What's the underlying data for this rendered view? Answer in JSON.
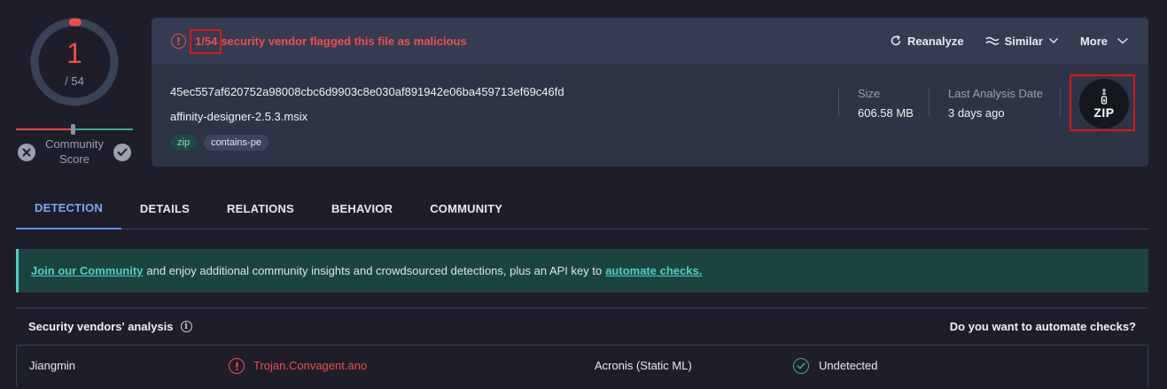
{
  "score": {
    "detections": "1",
    "total": "/ 54",
    "community_label": "Community Score"
  },
  "alert": {
    "count": "1/54",
    "text": "security vendor flagged this file as malicious"
  },
  "actions": {
    "reanalyze": "Reanalyze",
    "similar": "Similar",
    "more": "More"
  },
  "file": {
    "hash": "45ec557af620752a98008cbc6d9903c8e030af891942e06ba459713ef69c46fd",
    "name": "affinity-designer-2.5.3.msix",
    "tags": [
      "zip",
      "contains-pe"
    ]
  },
  "meta": {
    "size_label": "Size",
    "size_value": "606.58 MB",
    "date_label": "Last Analysis Date",
    "date_value": "3 days ago"
  },
  "file_type": "ZIP",
  "tabs": [
    "DETECTION",
    "DETAILS",
    "RELATIONS",
    "BEHAVIOR",
    "COMMUNITY"
  ],
  "banner": {
    "link1": "Join our Community",
    "middle": "and enjoy additional community insights and crowdsourced detections, plus an API key to",
    "link2": "automate checks."
  },
  "vendors": {
    "title": "Security vendors' analysis",
    "automate": "Do you want to automate checks?",
    "rows": [
      {
        "vendor1": "Jiangmin",
        "result1": "Trojan.Convagent.ano",
        "vendor2": "Acronis (Static ML)",
        "result2": "Undetected"
      }
    ]
  },
  "colors": {
    "malicious": "#ef4d4d",
    "clean": "#35b08a",
    "accent": "#7da7f2",
    "banner_link": "#4fd1c2"
  }
}
